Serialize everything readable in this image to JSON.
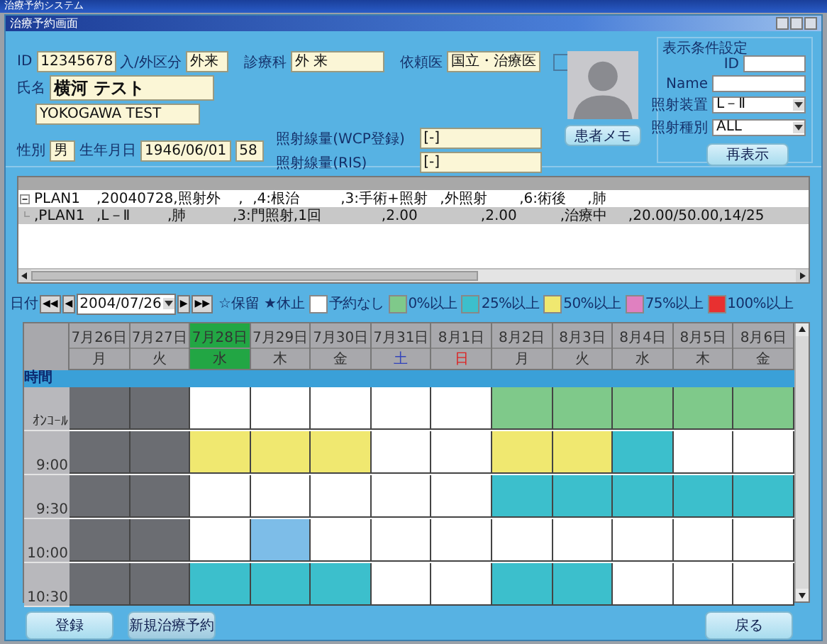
{
  "window": {
    "title": "治療予約システム"
  },
  "dialog": {
    "title": "治療予約画面"
  },
  "patient": {
    "id": {
      "label": "ID",
      "value": "12345678"
    },
    "in_out": {
      "label": "入/外区分",
      "value": "外来"
    },
    "department": {
      "label": "診療科",
      "value": "外 来"
    },
    "doctor": {
      "label": "依頼医",
      "value": "国立・治療医"
    },
    "flag_box": {
      "checked": false
    },
    "name": {
      "label": "氏名",
      "value": "横河 テスト"
    },
    "name_roman": {
      "value": "YOKOGAWA TEST"
    },
    "sex": {
      "label": "性別",
      "value": "男"
    },
    "birth": {
      "label": "生年月日",
      "value": "1946/06/01",
      "age": "58"
    },
    "dose_wcp": {
      "label": "照射線量(WCP登録)",
      "value": "[-]"
    },
    "dose_ris": {
      "label": "照射線量(RIS)",
      "value": "[-]"
    },
    "memo_button": "患者メモ"
  },
  "filter": {
    "title": "表示条件設定",
    "id_label": "ID",
    "name_label": "Name",
    "device": {
      "label": "照射装置",
      "value": "L－Ⅱ"
    },
    "type": {
      "label": "照射種別",
      "value": "ALL"
    },
    "refresh_button": "再表示"
  },
  "plans": [
    {
      "expanded": true,
      "selected": false,
      "cells": [
        "PLAN1",
        ",20040728",
        ",照射外",
        ",",
        ",4:根治",
        ",3:手術+照射",
        ",外照射",
        ",6:術後",
        ",肺"
      ]
    },
    {
      "expanded": false,
      "selected": true,
      "cells": [
        ",PLAN1",
        ",L－Ⅱ",
        ",肺",
        ",3:門照射",
        ",1回",
        ",2.00",
        ",2.00",
        ",治療中",
        ",20.00/50.00",
        ",14/25"
      ]
    }
  ],
  "nav": {
    "label": "日付",
    "first": "◀◀",
    "prev": "◀",
    "date": "2004/07/26",
    "next": "▶",
    "last": "▶▶",
    "hold": "☆保留",
    "pause": "★休止"
  },
  "legend": [
    {
      "label": "予約なし",
      "color": "#ffffff"
    },
    {
      "label": "0%以上",
      "color": "#7fc98a"
    },
    {
      "label": "25%以上",
      "color": "#3cbfcc"
    },
    {
      "label": "50%以上",
      "color": "#f0e870"
    },
    {
      "label": "75%以上",
      "color": "#e080c0"
    },
    {
      "label": "100%以上",
      "color": "#e83030"
    }
  ],
  "calendar": {
    "time_label": "時間",
    "days": [
      {
        "date": "7月26日",
        "weekday": "月",
        "kind": "weekday",
        "selected": false
      },
      {
        "date": "7月27日",
        "weekday": "火",
        "kind": "weekday",
        "selected": false
      },
      {
        "date": "7月28日",
        "weekday": "水",
        "kind": "weekday",
        "selected": true
      },
      {
        "date": "7月29日",
        "weekday": "木",
        "kind": "weekday",
        "selected": false
      },
      {
        "date": "7月30日",
        "weekday": "金",
        "kind": "weekday",
        "selected": false
      },
      {
        "date": "7月31日",
        "weekday": "土",
        "kind": "saturday",
        "selected": false
      },
      {
        "date": "8月1日",
        "weekday": "日",
        "kind": "sunday",
        "selected": false
      },
      {
        "date": "8月2日",
        "weekday": "月",
        "kind": "weekday",
        "selected": false
      },
      {
        "date": "8月3日",
        "weekday": "火",
        "kind": "weekday",
        "selected": false
      },
      {
        "date": "8月4日",
        "weekday": "水",
        "kind": "weekday",
        "selected": false
      },
      {
        "date": "8月5日",
        "weekday": "木",
        "kind": "weekday",
        "selected": false
      },
      {
        "date": "8月6日",
        "weekday": "金",
        "kind": "weekday",
        "selected": false
      }
    ],
    "rows": [
      {
        "time": "ｵﾝｺｰﾙ",
        "cells": [
          {
            "color": "#6b6d72"
          },
          {
            "color": "#6b6d72"
          },
          {
            "color": "#ffffff"
          },
          {
            "color": "#ffffff"
          },
          {
            "color": "#ffffff"
          },
          {
            "color": "#ffffff"
          },
          {
            "color": "#ffffff"
          },
          {
            "color": "#7fc98a"
          },
          {
            "color": "#7fc98a"
          },
          {
            "color": "#7fc98a"
          },
          {
            "color": "#7fc98a"
          },
          {
            "color": "#7fc98a"
          }
        ]
      },
      {
        "time": "9:00",
        "cells": [
          {
            "color": "#6b6d72"
          },
          {
            "color": "#6b6d72"
          },
          {
            "color": "#f0e870"
          },
          {
            "color": "#f0e870"
          },
          {
            "color": "#f0e870"
          },
          {
            "color": "#ffffff"
          },
          {
            "color": "#ffffff"
          },
          {
            "color": "#f0e870"
          },
          {
            "color": "#f0e870"
          },
          {
            "color": "#3cbfcc"
          },
          {
            "color": "#ffffff"
          },
          {
            "color": "#ffffff"
          }
        ]
      },
      {
        "time": "9:30",
        "cells": [
          {
            "color": "#6b6d72"
          },
          {
            "color": "#6b6d72"
          },
          {
            "color": "#ffffff"
          },
          {
            "color": "#ffffff"
          },
          {
            "color": "#ffffff"
          },
          {
            "color": "#ffffff"
          },
          {
            "color": "#ffffff"
          },
          {
            "color": "#3cbfcc"
          },
          {
            "color": "#3cbfcc"
          },
          {
            "color": "#3cbfcc"
          },
          {
            "color": "#3cbfcc"
          },
          {
            "color": "#3cbfcc"
          }
        ]
      },
      {
        "time": "10:00",
        "cells": [
          {
            "color": "#6b6d72"
          },
          {
            "color": "#6b6d72"
          },
          {
            "color": "#ffffff"
          },
          {
            "color": "#7dbde8"
          },
          {
            "color": "#ffffff"
          },
          {
            "color": "#ffffff"
          },
          {
            "color": "#ffffff"
          },
          {
            "color": "#ffffff"
          },
          {
            "color": "#ffffff"
          },
          {
            "color": "#ffffff"
          },
          {
            "color": "#ffffff"
          },
          {
            "color": "#ffffff"
          }
        ]
      },
      {
        "time": "10:30",
        "cells": [
          {
            "color": "#6b6d72"
          },
          {
            "color": "#6b6d72"
          },
          {
            "color": "#3cbfcc"
          },
          {
            "color": "#3cbfcc"
          },
          {
            "color": "#3cbfcc"
          },
          {
            "color": "#ffffff"
          },
          {
            "color": "#ffffff"
          },
          {
            "color": "#3cbfcc"
          },
          {
            "color": "#3cbfcc"
          },
          {
            "color": "#ffffff"
          },
          {
            "color": "#ffffff"
          },
          {
            "color": "#ffffff"
          }
        ]
      }
    ]
  },
  "buttons": {
    "register": "登録",
    "new_booking": "新規治療予約",
    "back": "戻る"
  }
}
